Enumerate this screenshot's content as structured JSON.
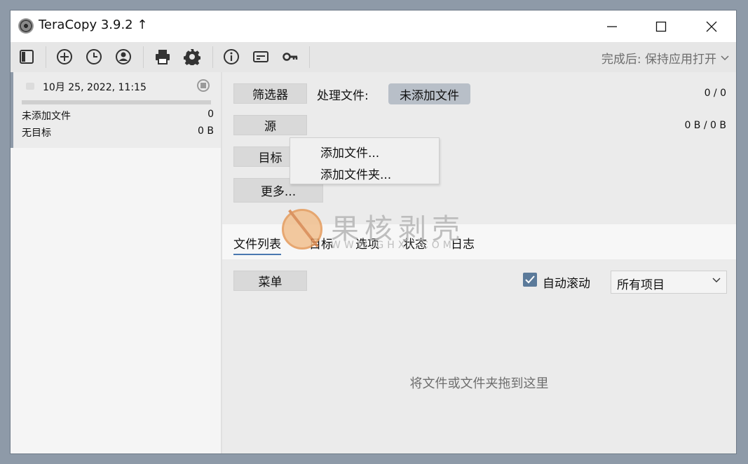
{
  "window": {
    "title": "TeraCopy 3.9.2",
    "update_arrow": "↑"
  },
  "toolbar": {
    "icons": [
      "panel-icon",
      "add-icon",
      "history-icon",
      "account-icon",
      "print-icon",
      "gear-icon",
      "info-icon",
      "license-icon",
      "key-icon"
    ],
    "after_done": "完成后: 保持应用打开"
  },
  "job": {
    "date": "10月 25, 2022, 11:15",
    "files_label": "未添加文件",
    "files_count": "0",
    "target_label": "无目标",
    "target_size": "0 B"
  },
  "main": {
    "filter_button": "筛选器",
    "processing_label": "处理文件:",
    "processing_value": "未添加文件",
    "file_count": "0 / 0",
    "source_button": "源",
    "size_count": "0 B / 0 B",
    "target_button": "目标",
    "more_button": "更多...",
    "dropdown_items": [
      "添加文件...",
      "添加文件夹..."
    ]
  },
  "tabs": [
    "文件列表",
    "目标",
    "选项",
    "状态",
    "日志"
  ],
  "list": {
    "menu_button": "菜单",
    "autoscroll_label": "自动滚动",
    "autoscroll_checked": true,
    "filter_select": "所有项目",
    "drop_hint": "将文件或文件夹拖到这里"
  },
  "watermark": {
    "text": "果核剥壳",
    "sub": "WWW.GHXI.COM"
  },
  "colors": {
    "accent": "#4a78b0",
    "checkbox": "#5b7a9a",
    "pill": "#b8bfc8",
    "frame": "#8e9aa8"
  }
}
